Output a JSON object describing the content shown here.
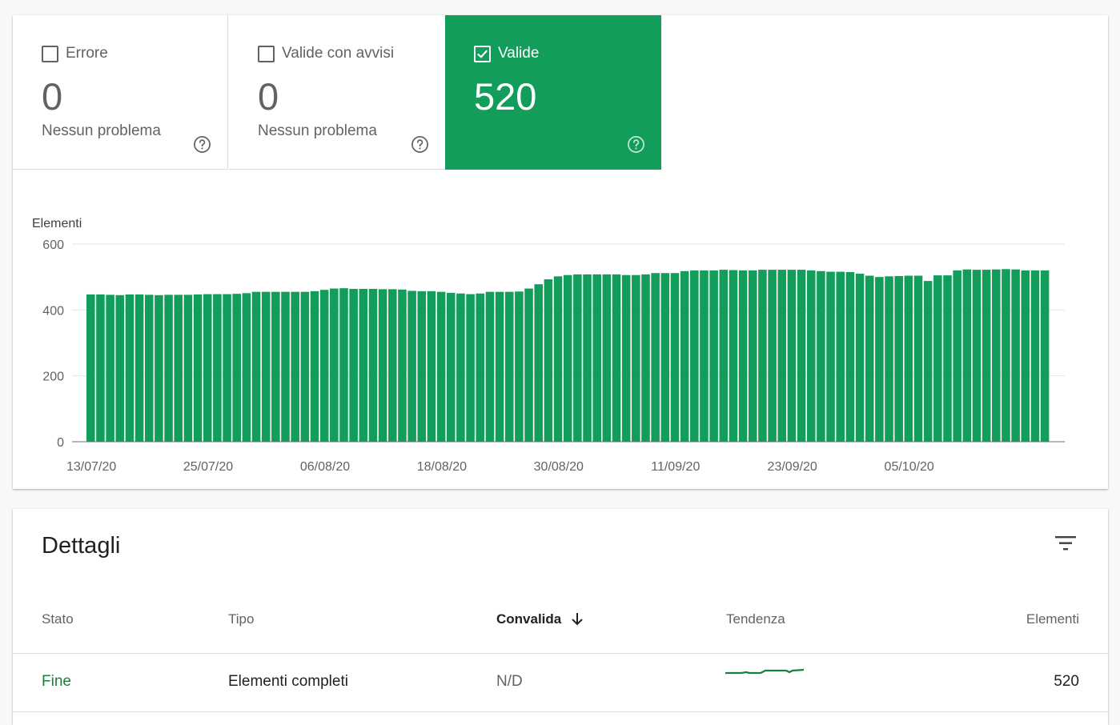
{
  "tiles": {
    "error": {
      "label": "Errore",
      "value": "0",
      "sub": "Nessun problema",
      "checked": false
    },
    "warnings": {
      "label": "Valide con avvisi",
      "value": "0",
      "sub": "Nessun problema",
      "checked": false
    },
    "valid": {
      "label": "Valide",
      "value": "520",
      "checked": true
    }
  },
  "colors": {
    "valid_green": "#129e5a",
    "status_green": "#188038"
  },
  "chart_data": {
    "type": "bar",
    "ylabel": "Elementi",
    "ylim": [
      0,
      600
    ],
    "yticks": [
      "600",
      "400",
      "200",
      "0"
    ],
    "xticks": [
      "13/07/20",
      "25/07/20",
      "06/08/20",
      "18/08/20",
      "30/08/20",
      "11/09/20",
      "23/09/20",
      "05/10/20"
    ],
    "grid": true,
    "series": [
      {
        "values": [
          447,
          447,
          446,
          445,
          447,
          447,
          446,
          445,
          446,
          446,
          446,
          447,
          448,
          448,
          448,
          449,
          451,
          455,
          455,
          455,
          455,
          455,
          455,
          457,
          461,
          465,
          466,
          464,
          464,
          464,
          463,
          463,
          462,
          458,
          457,
          457,
          455,
          452,
          450,
          448,
          450,
          455,
          455,
          455,
          456,
          465,
          478,
          493,
          502,
          506,
          508,
          508,
          508,
          508,
          508,
          506,
          506,
          508,
          512,
          512,
          512,
          518,
          520,
          520,
          520,
          522,
          521,
          520,
          520,
          522,
          522,
          522,
          522,
          522,
          520,
          518,
          516,
          516,
          515,
          510,
          504,
          500,
          502,
          503,
          504,
          504,
          488,
          505,
          505,
          520,
          523,
          522,
          522,
          523,
          524,
          523,
          520,
          520,
          520
        ]
      }
    ]
  },
  "details": {
    "title": "Dettagli",
    "columns": {
      "status": "Stato",
      "type": "Tipo",
      "validation": "Convalida",
      "trend": "Tendenza",
      "items": "Elementi"
    },
    "rows": [
      {
        "status": "Fine",
        "type": "Elementi completi",
        "validation": "N/D",
        "items": "520"
      }
    ]
  }
}
